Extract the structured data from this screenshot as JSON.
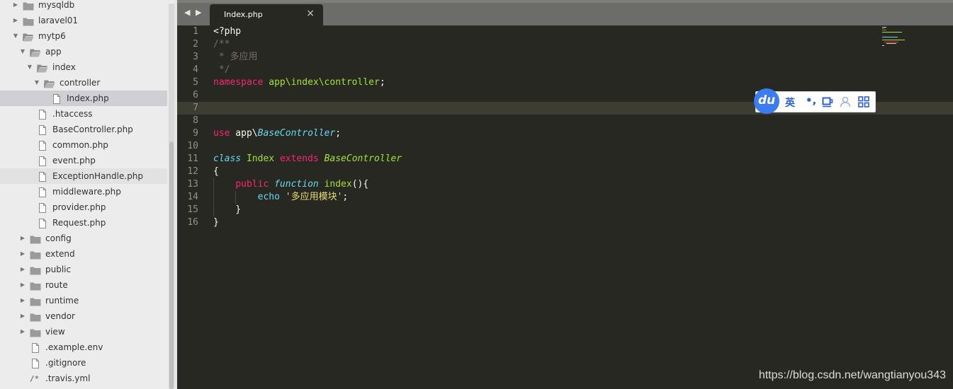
{
  "sidebar": {
    "items": [
      {
        "label": "mysqldb",
        "depth": 1,
        "type": "folder",
        "expanded": false,
        "selected": false
      },
      {
        "label": "laravel01",
        "depth": 1,
        "type": "folder",
        "expanded": false,
        "selected": false
      },
      {
        "label": "mytp6",
        "depth": 1,
        "type": "folder",
        "expanded": true,
        "selected": false
      },
      {
        "label": "app",
        "depth": 2,
        "type": "folder",
        "expanded": true,
        "selected": false
      },
      {
        "label": "index",
        "depth": 3,
        "type": "folder",
        "expanded": true,
        "selected": false
      },
      {
        "label": "controller",
        "depth": 4,
        "type": "folder",
        "expanded": true,
        "selected": false
      },
      {
        "label": "Index.php",
        "depth": 5,
        "type": "file",
        "selected": true
      },
      {
        "label": ".htaccess",
        "depth": 3,
        "type": "file",
        "selected": false
      },
      {
        "label": "BaseController.php",
        "depth": 3,
        "type": "file",
        "selected": false
      },
      {
        "label": "common.php",
        "depth": 3,
        "type": "file",
        "selected": false
      },
      {
        "label": "event.php",
        "depth": 3,
        "type": "file",
        "selected": false
      },
      {
        "label": "ExceptionHandle.php",
        "depth": 3,
        "type": "file",
        "selected": false,
        "hover": true
      },
      {
        "label": "middleware.php",
        "depth": 3,
        "type": "file",
        "selected": false
      },
      {
        "label": "provider.php",
        "depth": 3,
        "type": "file",
        "selected": false
      },
      {
        "label": "Request.php",
        "depth": 3,
        "type": "file",
        "selected": false
      },
      {
        "label": "config",
        "depth": 2,
        "type": "folder",
        "expanded": false,
        "selected": false
      },
      {
        "label": "extend",
        "depth": 2,
        "type": "folder",
        "expanded": false,
        "selected": false
      },
      {
        "label": "public",
        "depth": 2,
        "type": "folder",
        "expanded": false,
        "selected": false
      },
      {
        "label": "route",
        "depth": 2,
        "type": "folder",
        "expanded": false,
        "selected": false
      },
      {
        "label": "runtime",
        "depth": 2,
        "type": "folder",
        "expanded": false,
        "selected": false
      },
      {
        "label": "vendor",
        "depth": 2,
        "type": "folder",
        "expanded": false,
        "selected": false
      },
      {
        "label": "view",
        "depth": 2,
        "type": "folder",
        "expanded": false,
        "selected": false
      },
      {
        "label": ".example.env",
        "depth": 2,
        "type": "file",
        "selected": false
      },
      {
        "label": ".gitignore",
        "depth": 2,
        "type": "file",
        "selected": false
      },
      {
        "label": ".travis.yml",
        "depth": 2,
        "type": "comment-file",
        "selected": false
      }
    ]
  },
  "tabs": {
    "nav_arrows": "◀ ▶",
    "active": {
      "title": "Index.php",
      "close": "×"
    }
  },
  "editor": {
    "current_line": 7,
    "lines": [
      {
        "n": "1",
        "guides": 0,
        "tokens": [
          {
            "t": "<?php",
            "c": "plain"
          }
        ]
      },
      {
        "n": "2",
        "guides": 0,
        "tokens": [
          {
            "t": "/**",
            "c": "comment"
          }
        ]
      },
      {
        "n": "3",
        "guides": 0,
        "tokens": [
          {
            "t": " * 多应用",
            "c": "comment"
          }
        ]
      },
      {
        "n": "4",
        "guides": 0,
        "tokens": [
          {
            "t": " */",
            "c": "comment"
          }
        ]
      },
      {
        "n": "5",
        "guides": 0,
        "tokens": [
          {
            "t": "namespace",
            "c": "pink"
          },
          {
            "t": " ",
            "c": "plain"
          },
          {
            "t": "app\\index\\controller",
            "c": "green"
          },
          {
            "t": ";",
            "c": "plain"
          }
        ]
      },
      {
        "n": "6",
        "guides": 0,
        "tokens": []
      },
      {
        "n": "7",
        "guides": 0,
        "tokens": []
      },
      {
        "n": "8",
        "guides": 0,
        "tokens": []
      },
      {
        "n": "9",
        "guides": 0,
        "tokens": [
          {
            "t": "use",
            "c": "pink"
          },
          {
            "t": " app\\",
            "c": "plain"
          },
          {
            "t": "BaseController",
            "c": "cyan-i"
          },
          {
            "t": ";",
            "c": "plain"
          }
        ]
      },
      {
        "n": "10",
        "guides": 0,
        "tokens": []
      },
      {
        "n": "11",
        "guides": 0,
        "tokens": [
          {
            "t": "class",
            "c": "cyan-i"
          },
          {
            "t": " ",
            "c": "plain"
          },
          {
            "t": "Index",
            "c": "green"
          },
          {
            "t": " ",
            "c": "plain"
          },
          {
            "t": "extends",
            "c": "pink"
          },
          {
            "t": " ",
            "c": "plain"
          },
          {
            "t": "BaseController",
            "c": "green-i"
          }
        ]
      },
      {
        "n": "12",
        "guides": 0,
        "tokens": [
          {
            "t": "{",
            "c": "plain"
          }
        ]
      },
      {
        "n": "13",
        "guides": 1,
        "tokens": [
          {
            "t": "    ",
            "c": "plain"
          },
          {
            "t": "public",
            "c": "pink"
          },
          {
            "t": " ",
            "c": "plain"
          },
          {
            "t": "function",
            "c": "cyan-i"
          },
          {
            "t": " ",
            "c": "plain"
          },
          {
            "t": "index",
            "c": "green"
          },
          {
            "t": "(){",
            "c": "plain"
          }
        ]
      },
      {
        "n": "14",
        "guides": 2,
        "tokens": [
          {
            "t": "        ",
            "c": "plain"
          },
          {
            "t": "echo",
            "c": "cyan"
          },
          {
            "t": " ",
            "c": "plain"
          },
          {
            "t": "'多应用模块'",
            "c": "yellow"
          },
          {
            "t": ";",
            "c": "plain"
          }
        ]
      },
      {
        "n": "15",
        "guides": 1,
        "tokens": [
          {
            "t": "    }",
            "c": "plain"
          }
        ]
      },
      {
        "n": "16",
        "guides": 0,
        "tokens": [
          {
            "t": "}",
            "c": "plain"
          }
        ]
      }
    ]
  },
  "ime": {
    "logo": "du",
    "lang": "英",
    "punct": "•,"
  },
  "watermark": "https://blog.csdn.net/wangtianyou343",
  "colors": {
    "sidebar_bg": "#ececec",
    "editor_bg": "#272822",
    "tabbar_bg": "#6c6c6a",
    "selected_row": "#cfcfd4",
    "ime_blue": "#3c7cf2"
  }
}
